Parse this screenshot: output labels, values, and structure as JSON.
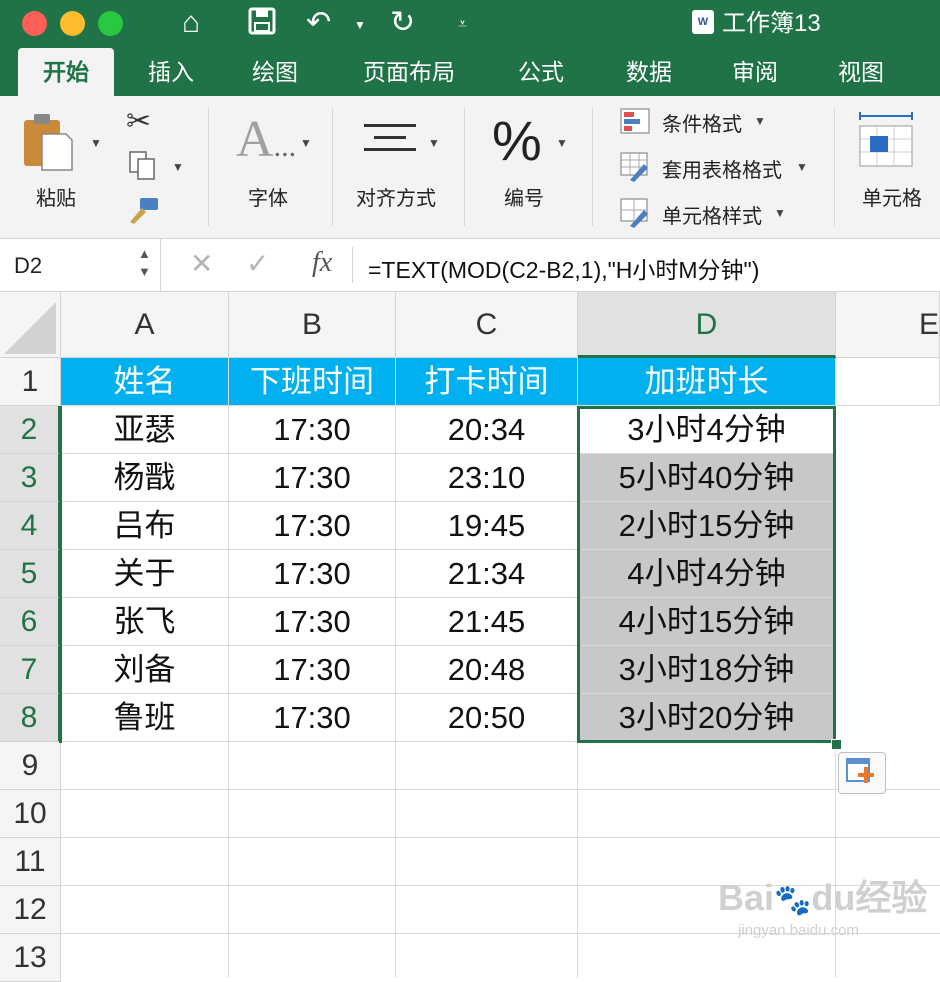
{
  "window": {
    "title": "工作簿13",
    "doc_icon": "W"
  },
  "tabs": [
    {
      "label": "开始",
      "active": true
    },
    {
      "label": "插入"
    },
    {
      "label": "绘图"
    },
    {
      "label": "页面布局"
    },
    {
      "label": "公式"
    },
    {
      "label": "数据"
    },
    {
      "label": "审阅"
    },
    {
      "label": "视图"
    }
  ],
  "ribbon": {
    "paste_label": "粘贴",
    "font_label": "字体",
    "align_label": "对齐方式",
    "number_label": "编号",
    "conditional_format": "条件格式",
    "table_format": "套用表格格式",
    "cell_style": "单元格样式",
    "cells_label": "单元格"
  },
  "formula_bar": {
    "name_box": "D2",
    "fx": "fx",
    "formula": "=TEXT(MOD(C2-B2,1),\"H小时M分钟\")"
  },
  "grid": {
    "columns": [
      "A",
      "B",
      "C",
      "D",
      "E"
    ],
    "rows": [
      "1",
      "2",
      "3",
      "4",
      "5",
      "6",
      "7",
      "8",
      "9",
      "10",
      "11",
      "12",
      "13"
    ],
    "header": [
      "姓名",
      "下班时间",
      "打卡时间",
      "加班时长"
    ],
    "data": [
      [
        "亚瑟",
        "17:30",
        "20:34",
        "3小时4分钟"
      ],
      [
        "杨戬",
        "17:30",
        "23:10",
        "5小时40分钟"
      ],
      [
        "吕布",
        "17:30",
        "19:45",
        "2小时15分钟"
      ],
      [
        "关于",
        "17:30",
        "21:34",
        "4小时4分钟"
      ],
      [
        "张飞",
        "17:30",
        "21:45",
        "4小时15分钟"
      ],
      [
        "刘备",
        "17:30",
        "20:48",
        "3小时18分钟"
      ],
      [
        "鲁班",
        "17:30",
        "20:50",
        "3小时20分钟"
      ]
    ]
  },
  "colors": {
    "brand": "#1f7346",
    "header_fill": "#00b0ef",
    "selection_fill": "#c8c8c8"
  }
}
